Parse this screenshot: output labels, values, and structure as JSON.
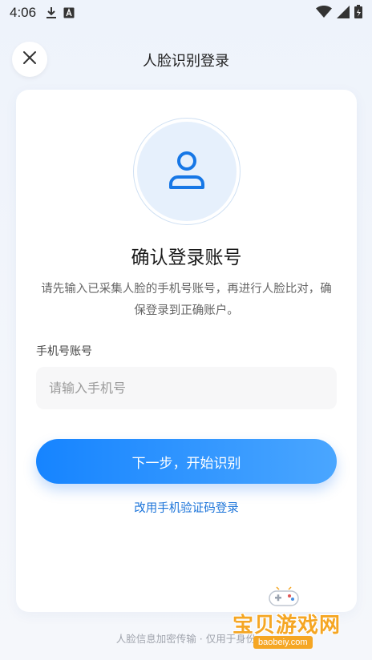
{
  "status_bar": {
    "time": "4:06",
    "icons": [
      "download-icon",
      "font-icon",
      "wifi-icon",
      "signal-icon",
      "battery-icon"
    ]
  },
  "header": {
    "title": "人脸识别登录",
    "close_icon": "close-icon"
  },
  "card": {
    "avatar_icon": "user-icon",
    "title": "确认登录账号",
    "description": "请先输入已采集人脸的手机号账号，再进行人脸比对，确保登录到正确账户。",
    "field_label": "手机号账号",
    "phone_input": {
      "value": "",
      "placeholder": "请输入手机号"
    },
    "next_button": "下一步，开始识别",
    "sms_link": "改用手机验证码登录"
  },
  "footer": {
    "note": "人脸信息加密传输 · 仅用于身份"
  },
  "watermark": {
    "text": "宝贝游戏网",
    "url": "baobeiy.com"
  },
  "colors": {
    "accent": "#1684ff",
    "link": "#1a73d9",
    "avatar_bg": "#e6f0fc"
  }
}
